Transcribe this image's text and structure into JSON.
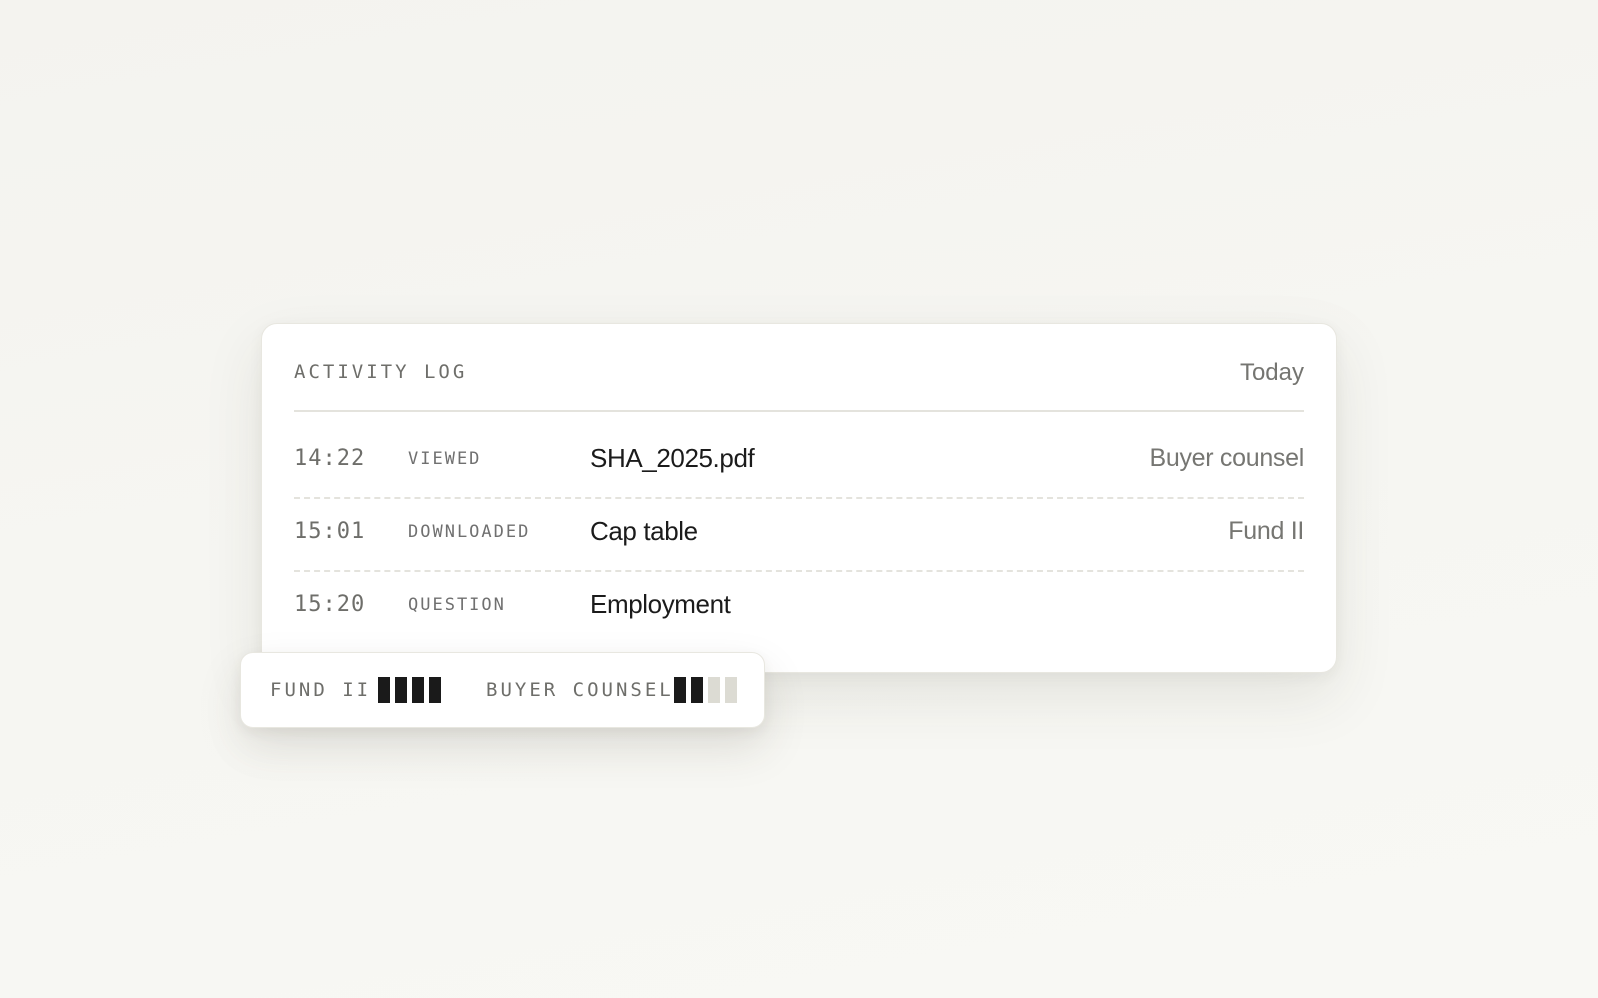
{
  "activity_log": {
    "title": "ACTIVITY LOG",
    "period": "Today",
    "entries": [
      {
        "time": "14:22",
        "action": "VIEWED",
        "document": "SHA_2025.pdf",
        "party": "Buyer counsel"
      },
      {
        "time": "15:01",
        "action": "DOWNLOADED",
        "document": "Cap table",
        "party": "Fund II"
      },
      {
        "time": "15:20",
        "action": "QUESTION",
        "document": "Employment",
        "party": ""
      }
    ]
  },
  "engagement": [
    {
      "label": "FUND II",
      "level": 4,
      "max": 4
    },
    {
      "label": "BUYER COUNSEL",
      "level": 2,
      "max": 4
    }
  ],
  "colors": {
    "bar_on": "#1a1a1a",
    "bar_off": "#dcdbd3"
  }
}
